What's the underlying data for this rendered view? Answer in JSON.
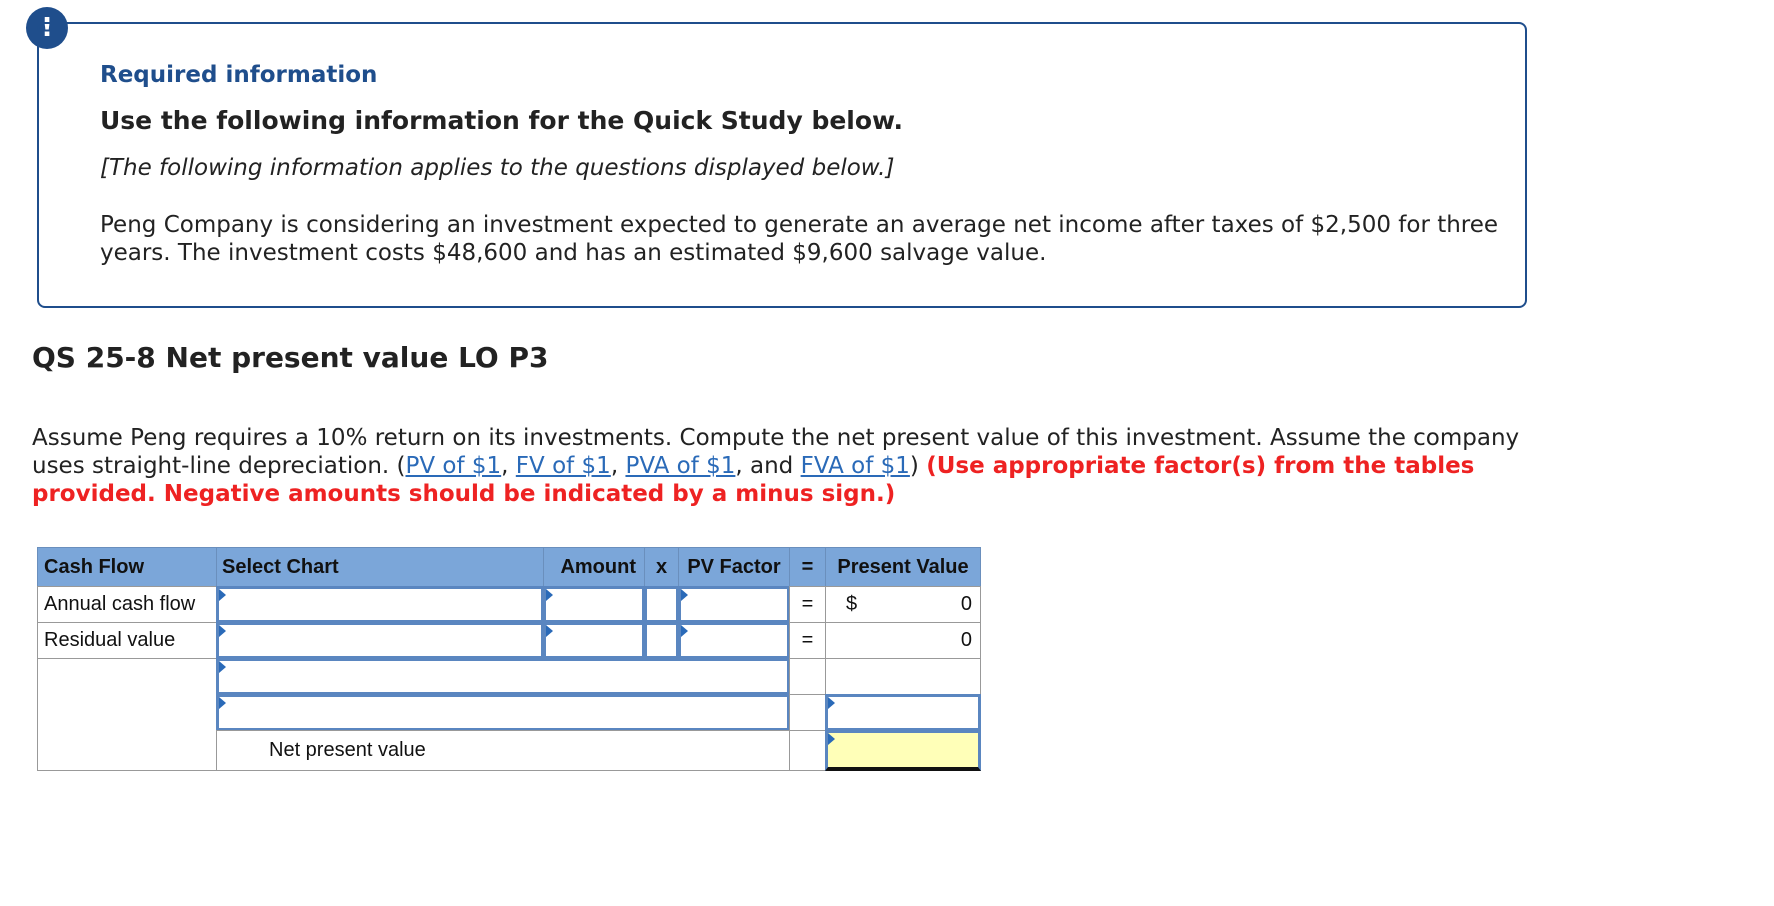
{
  "alert": {
    "glyph": "!"
  },
  "info": {
    "required_title": "Required information",
    "use_following": "Use the following information for the Quick Study below.",
    "applies": "[The following information applies to the questions displayed below.]",
    "scenario": "Peng Company is considering an investment expected to generate an average net income after taxes of $2,500 for three years. The investment costs $48,600 and has an estimated $9,600 salvage value."
  },
  "question": {
    "title": "QS 25-8 Net present value LO P3",
    "text_before_links": "Assume Peng requires a 10% return on its investments. Compute the net present value of this investment. Assume the company uses straight-line depreciation. (",
    "links": [
      "PV of $1",
      "FV of $1",
      "PVA of $1",
      "FVA of $1"
    ],
    "sep1": ", ",
    "sep2": ", ",
    "sep3": ", and ",
    "after_links": ") ",
    "warning": "(Use appropriate factor(s) from the tables provided. Negative amounts should be indicated by a minus sign.)"
  },
  "worksheet": {
    "headers": {
      "cash_flow": "Cash Flow",
      "select_chart": "Select Chart",
      "amount": "Amount",
      "times": "x",
      "pv_factor": "PV Factor",
      "equals": "=",
      "present_value": "Present Value"
    },
    "rows": [
      {
        "label": "Annual cash flow",
        "equals": "=",
        "currency": "$",
        "value": "0"
      },
      {
        "label": "Residual value",
        "equals": "=",
        "currency": "",
        "value": "0"
      }
    ],
    "npv_label": "Net present value"
  }
}
